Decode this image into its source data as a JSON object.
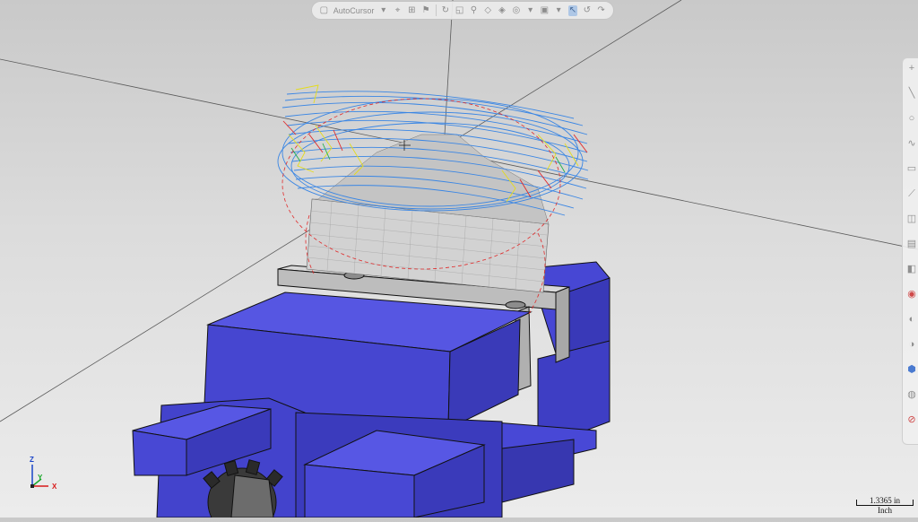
{
  "toolbar": {
    "cursor_mode_label": "AutoCursor",
    "icons": [
      "new-file-icon",
      "autocursor-dropdown-icon",
      "snap-point-icon",
      "snap-grid-icon",
      "flag-icon",
      "rotate-icon",
      "select-icon",
      "filter-icon",
      "wireframe-icon",
      "shaded-icon",
      "hidden-icon",
      "display-dropdown-icon",
      "box-icon",
      "box-dropdown-icon",
      "pointer-icon",
      "undo-icon",
      "redo-icon"
    ]
  },
  "sidebar": {
    "icons": [
      "plus-icon",
      "line-icon",
      "circle-icon",
      "spline-icon",
      "rectangle-icon",
      "measure-icon",
      "surface-icon",
      "stock-icon",
      "solid-icon",
      "toolpath-icon",
      "verify-icon",
      "backplot-icon",
      "info-icon",
      "settings-icon",
      "no-entry-icon"
    ]
  },
  "triad": {
    "z": "Z",
    "y": "Y",
    "x": "X"
  },
  "scale": {
    "value": "1.3365 in",
    "unit": "Inch"
  },
  "colors": {
    "vise": "#4a4ad8",
    "vise_dark": "#2e2ea8",
    "stock": "#c8c8c8",
    "toolpath_blue": "#2f7fe0",
    "toolpath_yellow": "#e8e020",
    "toolpath_red": "#e02020",
    "toolpath_green": "#20b040"
  }
}
